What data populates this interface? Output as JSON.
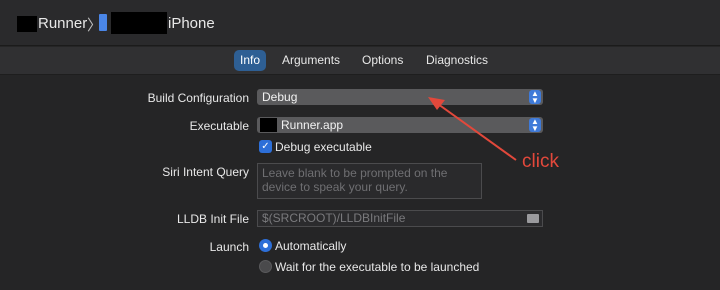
{
  "colors": {
    "accent": "#2d6fd8",
    "annotation": "#e2483b"
  },
  "titlebar": {
    "scheme": "Runner",
    "separator": "〉",
    "device": "iPhone"
  },
  "tabs": [
    {
      "label": "Info",
      "active": true
    },
    {
      "label": "Arguments",
      "active": false
    },
    {
      "label": "Options",
      "active": false
    },
    {
      "label": "Diagnostics",
      "active": false
    }
  ],
  "form": {
    "build_configuration": {
      "label": "Build Configuration",
      "value": "Debug"
    },
    "executable": {
      "label": "Executable",
      "value": "Runner.app"
    },
    "debug_executable": {
      "label": "Debug executable",
      "checked": true
    },
    "siri_intent": {
      "label": "Siri Intent Query",
      "placeholder": "Leave blank to be prompted on the device to speak your query."
    },
    "lldb_init": {
      "label": "LLDB Init File",
      "placeholder": "$(SRCROOT)/LLDBInitFile"
    },
    "launch": {
      "label": "Launch",
      "option_automatically": "Automatically",
      "option_wait": "Wait for the executable to be launched",
      "selected": "Automatically"
    }
  },
  "annotation": {
    "text": "click"
  }
}
